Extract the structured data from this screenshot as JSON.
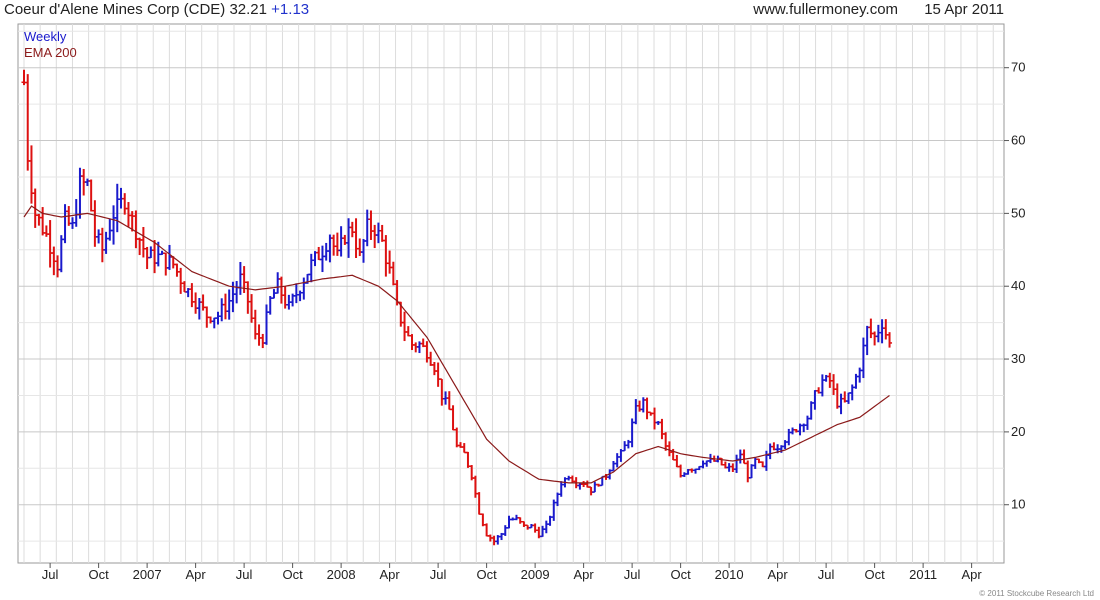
{
  "header": {
    "security": "Coeur d'Alene Mines Corp (CDE)",
    "price": "32.21",
    "change": "+1.13",
    "site": "www.fullermoney.com",
    "date": "15 Apr 2011"
  },
  "footer": {
    "copyright": "© 2011 Stockcube Research Ltd"
  },
  "colors": {
    "up": "#1a1acc",
    "down": "#dd1111",
    "ema": "#8b1a1a",
    "grid": "#dcdcdc"
  },
  "chart_data": {
    "type": "line",
    "title": "Coeur d'Alene Mines Corp (CDE) 32.21 +1.13",
    "subtitle": "Weekly",
    "ylabel": "",
    "xlabel": "",
    "ylim": [
      2,
      76
    ],
    "y_ticks": [
      10,
      20,
      30,
      40,
      50,
      60,
      70
    ],
    "y_axis_side": "right",
    "grid": true,
    "x_ticks": [
      {
        "label": "Jul",
        "w": 7
      },
      {
        "label": "Oct",
        "w": 20
      },
      {
        "label": "2007",
        "w": 33
      },
      {
        "label": "Apr",
        "w": 46
      },
      {
        "label": "Jul",
        "w": 59
      },
      {
        "label": "Oct",
        "w": 72
      },
      {
        "label": "2008",
        "w": 85
      },
      {
        "label": "Apr",
        "w": 98
      },
      {
        "label": "Jul",
        "w": 111
      },
      {
        "label": "Oct",
        "w": 124
      },
      {
        "label": "2009",
        "w": 137
      },
      {
        "label": "Apr",
        "w": 150
      },
      {
        "label": "Jul",
        "w": 163
      },
      {
        "label": "Oct",
        "w": 176
      },
      {
        "label": "2010",
        "w": 189
      },
      {
        "label": "Apr",
        "w": 202
      },
      {
        "label": "Jul",
        "w": 215
      },
      {
        "label": "Oct",
        "w": 228
      },
      {
        "label": "2011",
        "w": 241
      },
      {
        "label": "Apr",
        "w": 254
      }
    ],
    "legend": [
      {
        "label": "Weekly",
        "color": "#1a1acc"
      },
      {
        "label": "EMA 200",
        "color": "#8b1a1a"
      }
    ],
    "price_keypoints": [
      [
        0,
        68
      ],
      [
        1,
        58
      ],
      [
        3,
        50
      ],
      [
        6,
        47
      ],
      [
        9,
        43
      ],
      [
        11,
        49
      ],
      [
        13,
        48
      ],
      [
        15,
        54
      ],
      [
        17,
        54
      ],
      [
        19,
        47
      ],
      [
        21,
        45
      ],
      [
        24,
        50
      ],
      [
        27,
        52
      ],
      [
        29,
        49
      ],
      [
        33,
        44
      ],
      [
        36,
        44
      ],
      [
        40,
        43
      ],
      [
        43,
        40
      ],
      [
        46,
        38
      ],
      [
        49,
        36
      ],
      [
        52,
        36
      ],
      [
        55,
        38
      ],
      [
        58,
        41
      ],
      [
        60,
        38
      ],
      [
        62,
        33
      ],
      [
        64,
        33
      ],
      [
        66,
        38
      ],
      [
        68,
        40
      ],
      [
        71,
        37
      ],
      [
        74,
        40
      ],
      [
        77,
        43
      ],
      [
        80,
        45
      ],
      [
        82,
        47
      ],
      [
        84,
        44
      ],
      [
        86,
        47
      ],
      [
        88,
        48
      ],
      [
        90,
        44
      ],
      [
        92,
        48
      ],
      [
        94,
        48
      ],
      [
        96,
        46
      ],
      [
        98,
        42
      ],
      [
        100,
        37
      ],
      [
        102,
        34
      ],
      [
        104,
        32
      ],
      [
        106,
        32
      ],
      [
        108,
        31
      ],
      [
        110,
        29
      ],
      [
        112,
        25
      ],
      [
        114,
        23
      ],
      [
        116,
        18
      ],
      [
        118,
        17
      ],
      [
        120,
        14
      ],
      [
        122,
        9
      ],
      [
        124,
        6
      ],
      [
        126,
        5
      ],
      [
        128,
        6
      ],
      [
        130,
        8
      ],
      [
        132,
        8
      ],
      [
        134,
        7
      ],
      [
        136,
        7
      ],
      [
        138,
        6
      ],
      [
        140,
        7
      ],
      [
        142,
        10
      ],
      [
        144,
        13
      ],
      [
        146,
        14
      ],
      [
        148,
        13
      ],
      [
        150,
        13
      ],
      [
        152,
        12
      ],
      [
        154,
        13
      ],
      [
        156,
        14
      ],
      [
        158,
        16
      ],
      [
        160,
        17
      ],
      [
        162,
        19
      ],
      [
        164,
        23
      ],
      [
        166,
        24
      ],
      [
        168,
        22
      ],
      [
        170,
        21
      ],
      [
        172,
        18
      ],
      [
        174,
        16
      ],
      [
        176,
        14
      ],
      [
        178,
        15
      ],
      [
        180,
        15
      ],
      [
        182,
        16
      ],
      [
        184,
        16
      ],
      [
        186,
        16
      ],
      [
        188,
        15
      ],
      [
        190,
        15
      ],
      [
        192,
        17
      ],
      [
        194,
        14
      ],
      [
        196,
        16
      ],
      [
        198,
        15
      ],
      [
        200,
        18
      ],
      [
        202,
        18
      ],
      [
        204,
        19
      ],
      [
        206,
        20
      ],
      [
        208,
        21
      ],
      [
        210,
        22
      ],
      [
        212,
        25
      ],
      [
        214,
        27
      ],
      [
        216,
        27
      ],
      [
        218,
        24
      ],
      [
        220,
        24
      ],
      [
        222,
        26
      ],
      [
        224,
        29
      ],
      [
        226,
        34
      ],
      [
        228,
        33
      ],
      [
        230,
        35
      ],
      [
        232,
        32
      ]
    ],
    "ema_keypoints": [
      [
        0,
        49.5
      ],
      [
        2,
        51
      ],
      [
        5,
        50
      ],
      [
        10,
        49.5
      ],
      [
        17,
        50
      ],
      [
        25,
        49
      ],
      [
        35,
        46
      ],
      [
        45,
        42
      ],
      [
        55,
        40
      ],
      [
        62,
        39.5
      ],
      [
        70,
        40
      ],
      [
        80,
        41
      ],
      [
        88,
        41.5
      ],
      [
        95,
        40
      ],
      [
        100,
        38
      ],
      [
        108,
        33
      ],
      [
        116,
        26
      ],
      [
        124,
        19
      ],
      [
        130,
        16
      ],
      [
        138,
        13.5
      ],
      [
        146,
        13
      ],
      [
        152,
        13
      ],
      [
        158,
        14.5
      ],
      [
        164,
        17
      ],
      [
        170,
        18
      ],
      [
        176,
        17
      ],
      [
        182,
        16.5
      ],
      [
        190,
        16
      ],
      [
        196,
        16.5
      ],
      [
        204,
        17.5
      ],
      [
        212,
        19.5
      ],
      [
        218,
        21
      ],
      [
        224,
        22
      ],
      [
        228,
        23.5
      ],
      [
        232,
        25
      ]
    ]
  }
}
